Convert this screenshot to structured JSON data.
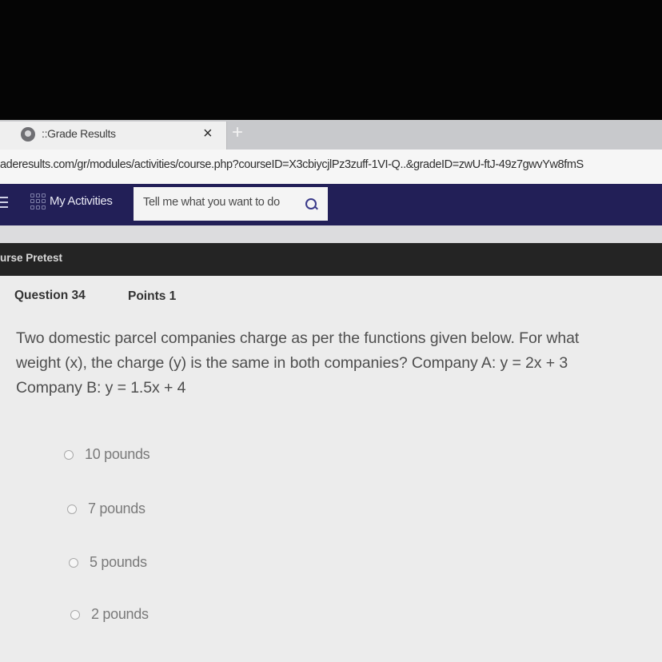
{
  "browser": {
    "tab_title": "::Grade Results",
    "close_glyph": "×",
    "new_tab_glyph": "+",
    "url": "aderesults.com/gr/modules/activities/course.php?courseID=X3cbiycjlPz3zuff-1VI-Q..&gradeID=zwU-ftJ-49z7gwvYw8fmS"
  },
  "navbar": {
    "activities_label": "My Activities",
    "search_placeholder": "Tell me what you want to do"
  },
  "course": {
    "title": "urse Pretest"
  },
  "question": {
    "number_label": "Question 34",
    "points_label": "Points 1",
    "text_line1": "Two domestic parcel companies charge as per the functions given below. For what",
    "text_line2": "weight (x), the charge (y) is the same in both companies? Company A: y = 2x + 3",
    "text_line3": "Company B: y = 1.5x + 4",
    "options": [
      {
        "label": "10 pounds"
      },
      {
        "label": "7 pounds"
      },
      {
        "label": "5 pounds"
      },
      {
        "label": "2 pounds"
      }
    ]
  },
  "icons": [
    "globe-icon",
    "close-icon",
    "plus-icon",
    "hamburger-icon",
    "grid-icon",
    "search-icon",
    "radio-button-icon"
  ]
}
